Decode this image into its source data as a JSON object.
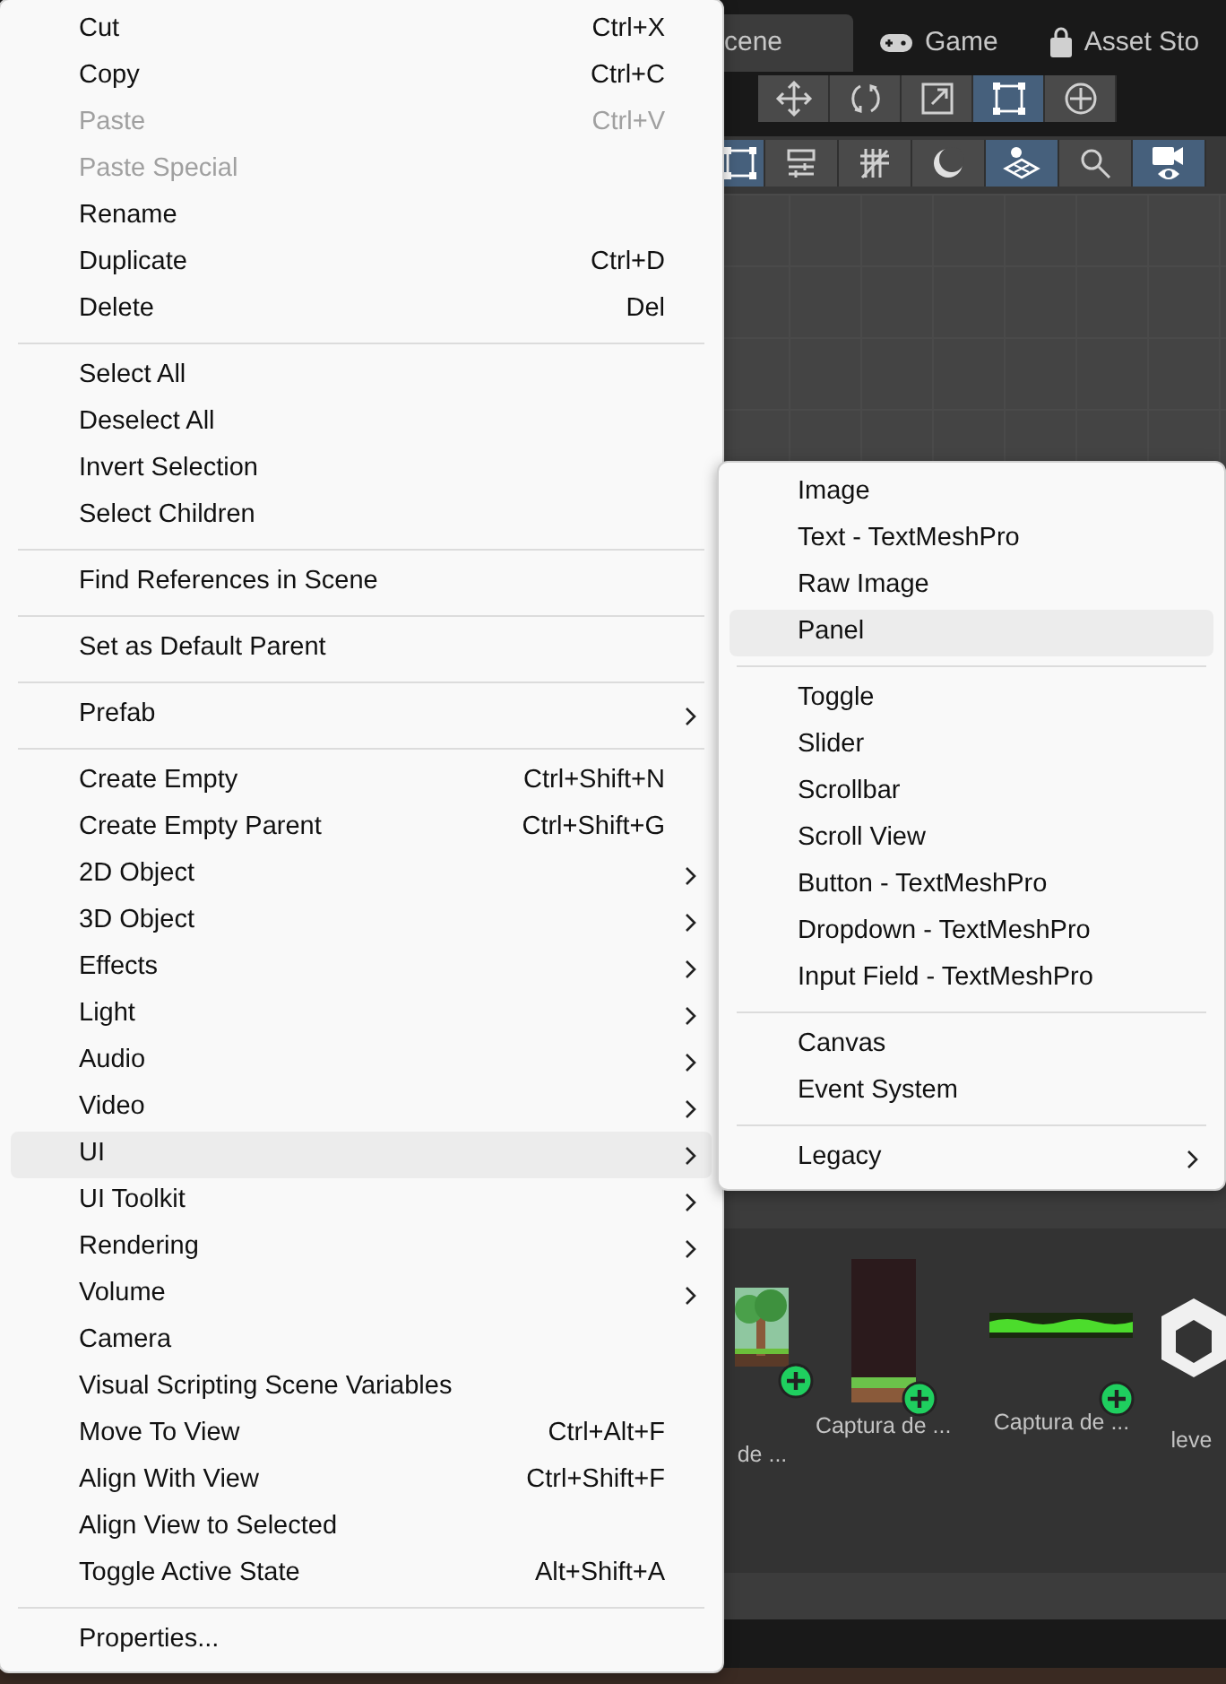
{
  "editor": {
    "tabs": [
      {
        "label": "cene",
        "selected": true
      },
      {
        "label": "Game",
        "selected": false
      },
      {
        "label": "Asset Sto",
        "selected": false
      }
    ],
    "tools": [
      {
        "selected": false
      },
      {
        "selected": false
      },
      {
        "selected": false
      },
      {
        "selected": true
      },
      {
        "selected": false
      }
    ],
    "view_tools": [
      {
        "selected": true
      },
      {
        "selected": false
      },
      {
        "selected": false
      },
      {
        "selected": false
      },
      {
        "selected": true
      },
      {
        "selected": false
      },
      {
        "selected": true
      }
    ],
    "assets": [
      {
        "label": "de ...",
        "addable": true
      },
      {
        "label": "Captura de ...",
        "addable": true
      },
      {
        "label": "Captura de ...",
        "addable": true
      },
      {
        "label": "leve",
        "addable": false
      }
    ]
  },
  "context_menu": {
    "items": [
      {
        "kind": "item",
        "label": "Cut",
        "shortcut": "Ctrl+X",
        "disabled": false,
        "submenu": false,
        "highlighted": false
      },
      {
        "kind": "item",
        "label": "Copy",
        "shortcut": "Ctrl+C",
        "disabled": false,
        "submenu": false,
        "highlighted": false
      },
      {
        "kind": "item",
        "label": "Paste",
        "shortcut": "Ctrl+V",
        "disabled": true,
        "submenu": false,
        "highlighted": false
      },
      {
        "kind": "item",
        "label": "Paste Special",
        "disabled": true,
        "submenu": false,
        "highlighted": false
      },
      {
        "kind": "item",
        "label": "Rename",
        "disabled": false,
        "submenu": false,
        "highlighted": false
      },
      {
        "kind": "item",
        "label": "Duplicate",
        "shortcut": "Ctrl+D",
        "disabled": false,
        "submenu": false,
        "highlighted": false
      },
      {
        "kind": "item",
        "label": "Delete",
        "shortcut": "Del",
        "disabled": false,
        "submenu": false,
        "highlighted": false
      },
      {
        "kind": "separator"
      },
      {
        "kind": "item",
        "label": "Select All",
        "disabled": false,
        "submenu": false,
        "highlighted": false
      },
      {
        "kind": "item",
        "label": "Deselect All",
        "disabled": false,
        "submenu": false,
        "highlighted": false
      },
      {
        "kind": "item",
        "label": "Invert Selection",
        "disabled": false,
        "submenu": false,
        "highlighted": false
      },
      {
        "kind": "item",
        "label": "Select Children",
        "disabled": false,
        "submenu": false,
        "highlighted": false
      },
      {
        "kind": "separator"
      },
      {
        "kind": "item",
        "label": "Find References in Scene",
        "disabled": false,
        "submenu": false,
        "highlighted": false
      },
      {
        "kind": "separator"
      },
      {
        "kind": "item",
        "label": "Set as Default Parent",
        "disabled": false,
        "submenu": false,
        "highlighted": false
      },
      {
        "kind": "separator"
      },
      {
        "kind": "item",
        "label": "Prefab",
        "disabled": false,
        "submenu": true,
        "highlighted": false
      },
      {
        "kind": "separator"
      },
      {
        "kind": "item",
        "label": "Create Empty",
        "shortcut": "Ctrl+Shift+N",
        "disabled": false,
        "submenu": false,
        "highlighted": false
      },
      {
        "kind": "item",
        "label": "Create Empty Parent",
        "shortcut": "Ctrl+Shift+G",
        "disabled": false,
        "submenu": false,
        "highlighted": false
      },
      {
        "kind": "item",
        "label": "2D Object",
        "disabled": false,
        "submenu": true,
        "highlighted": false
      },
      {
        "kind": "item",
        "label": "3D Object",
        "disabled": false,
        "submenu": true,
        "highlighted": false
      },
      {
        "kind": "item",
        "label": "Effects",
        "disabled": false,
        "submenu": true,
        "highlighted": false
      },
      {
        "kind": "item",
        "label": "Light",
        "disabled": false,
        "submenu": true,
        "highlighted": false
      },
      {
        "kind": "item",
        "label": "Audio",
        "disabled": false,
        "submenu": true,
        "highlighted": false
      },
      {
        "kind": "item",
        "label": "Video",
        "disabled": false,
        "submenu": true,
        "highlighted": false
      },
      {
        "kind": "item",
        "label": "UI",
        "disabled": false,
        "submenu": true,
        "highlighted": true
      },
      {
        "kind": "item",
        "label": "UI Toolkit",
        "disabled": false,
        "submenu": true,
        "highlighted": false
      },
      {
        "kind": "item",
        "label": "Rendering",
        "disabled": false,
        "submenu": true,
        "highlighted": false
      },
      {
        "kind": "item",
        "label": "Volume",
        "disabled": false,
        "submenu": true,
        "highlighted": false
      },
      {
        "kind": "item",
        "label": "Camera",
        "disabled": false,
        "submenu": false,
        "highlighted": false
      },
      {
        "kind": "item",
        "label": "Visual Scripting Scene Variables",
        "disabled": false,
        "submenu": false,
        "highlighted": false
      },
      {
        "kind": "item",
        "label": "Move To View",
        "shortcut": "Ctrl+Alt+F",
        "disabled": false,
        "submenu": false,
        "highlighted": false
      },
      {
        "kind": "item",
        "label": "Align With View",
        "shortcut": "Ctrl+Shift+F",
        "disabled": false,
        "submenu": false,
        "highlighted": false
      },
      {
        "kind": "item",
        "label": "Align View to Selected",
        "disabled": false,
        "submenu": false,
        "highlighted": false
      },
      {
        "kind": "item",
        "label": "Toggle Active State",
        "shortcut": "Alt+Shift+A",
        "disabled": false,
        "submenu": false,
        "highlighted": false
      },
      {
        "kind": "separator"
      },
      {
        "kind": "item",
        "label": "Properties...",
        "disabled": false,
        "submenu": false,
        "highlighted": false
      }
    ]
  },
  "submenu": {
    "items": [
      {
        "kind": "item",
        "label": "Image",
        "submenu": false,
        "highlighted": false
      },
      {
        "kind": "item",
        "label": "Text - TextMeshPro",
        "submenu": false,
        "highlighted": false
      },
      {
        "kind": "item",
        "label": "Raw Image",
        "submenu": false,
        "highlighted": false
      },
      {
        "kind": "item",
        "label": "Panel",
        "submenu": false,
        "highlighted": true
      },
      {
        "kind": "separator"
      },
      {
        "kind": "item",
        "label": "Toggle",
        "submenu": false,
        "highlighted": false
      },
      {
        "kind": "item",
        "label": "Slider",
        "submenu": false,
        "highlighted": false
      },
      {
        "kind": "item",
        "label": "Scrollbar",
        "submenu": false,
        "highlighted": false
      },
      {
        "kind": "item",
        "label": "Scroll View",
        "submenu": false,
        "highlighted": false
      },
      {
        "kind": "item",
        "label": "Button - TextMeshPro",
        "submenu": false,
        "highlighted": false
      },
      {
        "kind": "item",
        "label": "Dropdown - TextMeshPro",
        "submenu": false,
        "highlighted": false
      },
      {
        "kind": "item",
        "label": "Input Field - TextMeshPro",
        "submenu": false,
        "highlighted": false
      },
      {
        "kind": "separator"
      },
      {
        "kind": "item",
        "label": "Canvas",
        "submenu": false,
        "highlighted": false
      },
      {
        "kind": "item",
        "label": "Event System",
        "submenu": false,
        "highlighted": false
      },
      {
        "kind": "separator"
      },
      {
        "kind": "item",
        "label": "Legacy",
        "submenu": true,
        "highlighted": false
      }
    ]
  }
}
